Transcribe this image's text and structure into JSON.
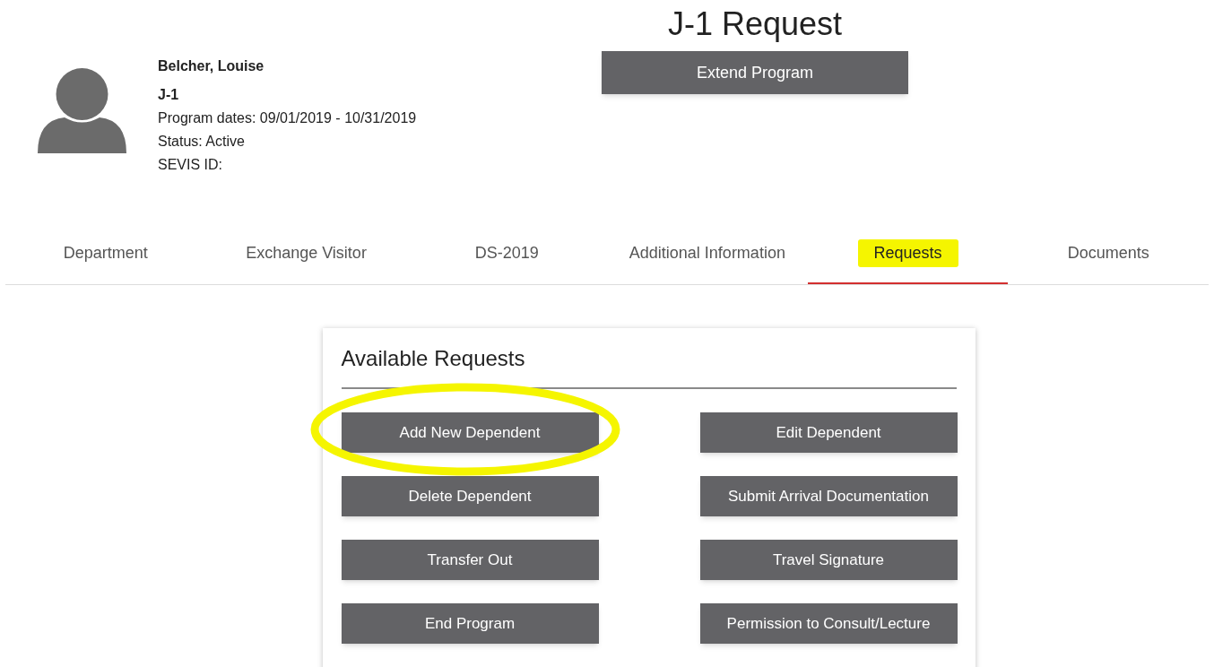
{
  "page_title": "J-1 Request",
  "header_button": "Extend Program",
  "profile": {
    "name": "Belcher, Louise",
    "visa_type": "J-1",
    "program_dates": "Program dates: 09/01/2019 - 10/31/2019",
    "status": "Status: Active",
    "sevis_id": "SEVIS ID:"
  },
  "tabs": [
    {
      "label": "Department",
      "selected": false,
      "highlighted": false
    },
    {
      "label": "Exchange Visitor",
      "selected": false,
      "highlighted": false
    },
    {
      "label": "DS-2019",
      "selected": false,
      "highlighted": false
    },
    {
      "label": "Additional Information",
      "selected": false,
      "highlighted": false
    },
    {
      "label": "Requests",
      "selected": true,
      "highlighted": true
    },
    {
      "label": "Documents",
      "selected": false,
      "highlighted": false
    }
  ],
  "card": {
    "title": "Available Requests",
    "buttons": [
      {
        "label": "Add New Dependent",
        "circled": true
      },
      {
        "label": "Edit Dependent",
        "circled": false
      },
      {
        "label": "Delete Dependent",
        "circled": false
      },
      {
        "label": "Submit Arrival Documentation",
        "circled": false
      },
      {
        "label": "Transfer Out",
        "circled": false
      },
      {
        "label": "Travel Signature",
        "circled": false
      },
      {
        "label": "End Program",
        "circled": false
      },
      {
        "label": "Permission to Consult/Lecture",
        "circled": false
      }
    ]
  }
}
